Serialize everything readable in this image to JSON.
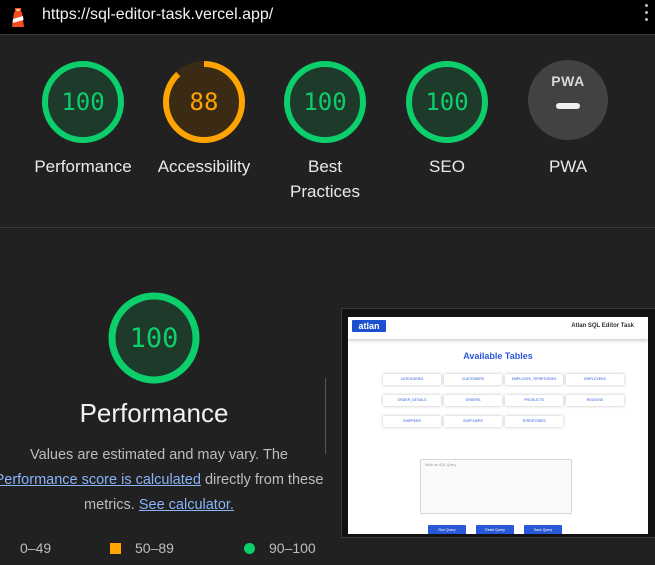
{
  "topbar": {
    "url": "https://sql-editor-task.vercel.app/",
    "logo_icon": "lighthouse-icon",
    "menu_icon": "kebab-menu-icon"
  },
  "colors": {
    "pass": "#0cce6b",
    "average": "#ffa400",
    "fail": "#ff4e42",
    "link": "#8ab4f8"
  },
  "categories": [
    {
      "label": "Performance",
      "score": 100,
      "score_text": "100",
      "rating": "pass"
    },
    {
      "label": "Accessibility",
      "score": 88,
      "score_text": "88",
      "rating": "average"
    },
    {
      "label": "Best\nPractices",
      "label_line1": "Best",
      "label_line2": "Practices",
      "score": 100,
      "score_text": "100",
      "rating": "pass"
    },
    {
      "label": "SEO",
      "score": 100,
      "score_text": "100",
      "rating": "pass"
    },
    {
      "label": "PWA",
      "badge_text": "PWA",
      "rating": "not-applicable"
    }
  ],
  "performance": {
    "score": 100,
    "score_text": "100",
    "title": "Performance",
    "desc_part1": "Values are estimated and may vary. The",
    "desc_link": "Performance score is calculated",
    "desc_part2": "directly from these metrics.",
    "calc_link": "See calculator."
  },
  "legend": [
    {
      "range": "0–49",
      "shape": "triangle"
    },
    {
      "range": "50–89",
      "shape": "square"
    },
    {
      "range": "90–100",
      "shape": "circle"
    }
  ],
  "thumbnail": {
    "logo": "atlan",
    "app_title": "Atlan SQL Editor Task",
    "heading": "Available Tables",
    "tables": [
      "CATEGORIES",
      "CUSTOMERS",
      "EMPLOYEE_TERRITORIES",
      "EMPLOYEES",
      "ORDER_DETAILS",
      "ORDERS",
      "PRODUCTS",
      "REGIONS",
      "SHIPPERS",
      "SUPPLIERS",
      "TERRITORIES"
    ],
    "query_placeholder": "Write an SQL Query",
    "buttons": [
      "Run Query",
      "Reset Query",
      "Save Query"
    ]
  }
}
